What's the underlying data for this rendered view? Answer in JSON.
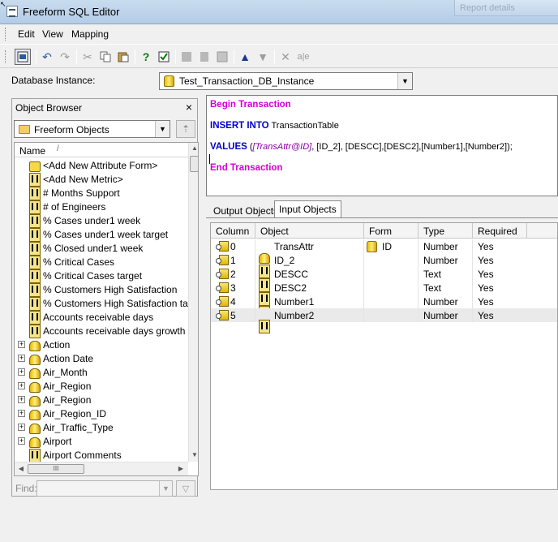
{
  "window": {
    "title": "Freeform SQL Editor",
    "background_window_title": "Report details"
  },
  "menu": {
    "items": [
      "Edit",
      "View",
      "Mapping"
    ]
  },
  "database_instance": {
    "label": "Database Instance:",
    "value": "Test_Transaction_DB_Instance"
  },
  "object_browser": {
    "title": "Object Browser",
    "close": "×",
    "folder": "Freeform Objects",
    "column_header": "Name",
    "sort_indicator": "/",
    "items": [
      {
        "label": "<Add New Attribute Form>",
        "icon": "add-attribute-form-icon",
        "expandable": false
      },
      {
        "label": "<Add New Metric>",
        "icon": "metric-icon",
        "expandable": false
      },
      {
        "label": "# Months Support",
        "icon": "metric-icon",
        "expandable": false
      },
      {
        "label": "# of Engineers",
        "icon": "metric-icon",
        "expandable": false
      },
      {
        "label": "% Cases under1 week",
        "icon": "metric-icon",
        "expandable": false
      },
      {
        "label": "% Cases under1 week target",
        "icon": "metric-icon",
        "expandable": false
      },
      {
        "label": "% Closed under1 week",
        "icon": "metric-icon",
        "expandable": false
      },
      {
        "label": "% Critical Cases",
        "icon": "metric-icon",
        "expandable": false
      },
      {
        "label": "% Critical Cases target",
        "icon": "metric-icon",
        "expandable": false
      },
      {
        "label": "% Customers High Satisfaction",
        "icon": "metric-icon",
        "expandable": false
      },
      {
        "label": "% Customers High Satisfaction ta",
        "icon": "metric-icon",
        "expandable": false
      },
      {
        "label": "Accounts receivable days",
        "icon": "metric-icon",
        "expandable": false
      },
      {
        "label": "Accounts receivable days growth",
        "icon": "metric-icon",
        "expandable": false
      },
      {
        "label": "Action",
        "icon": "attribute-icon",
        "expandable": true
      },
      {
        "label": "Action Date",
        "icon": "attribute-icon",
        "expandable": true
      },
      {
        "label": "Air_Month",
        "icon": "attribute-icon",
        "expandable": true
      },
      {
        "label": "Air_Region",
        "icon": "attribute-icon",
        "expandable": true
      },
      {
        "label": "Air_Region",
        "icon": "attribute-icon",
        "expandable": true
      },
      {
        "label": "Air_Region_ID",
        "icon": "attribute-icon",
        "expandable": true
      },
      {
        "label": "Air_Traffic_Type",
        "icon": "attribute-icon",
        "expandable": true
      },
      {
        "label": "Airport",
        "icon": "attribute-icon",
        "expandable": true
      },
      {
        "label": "Airport Comments",
        "icon": "metric-icon",
        "expandable": false
      }
    ],
    "find_label": "Find:",
    "find_value": "",
    "hscroll_grip": "III"
  },
  "sql": {
    "line1": "Begin Transaction",
    "line2_kw": "INSERT INTO",
    "line2_rest": " TransactionTable",
    "line3_kw": "VALUES",
    "line3_open": " (",
    "line3_italic": "[TransAttr@ID]",
    "line3_rest": ", [ID_2], [DESCC],[DESC2],[Number1],[Number2]);",
    "line4": "End Transaction"
  },
  "tabs": {
    "output": "Output Objects",
    "input": "Input Objects",
    "active": "Input Objects"
  },
  "grid": {
    "headers": [
      "Column",
      "Object",
      "Form",
      "Type",
      "Required"
    ],
    "rows": [
      {
        "column": "0",
        "object": "TransAttr",
        "object_icon": "attribute-icon",
        "form": "ID",
        "type": "Number",
        "required": "Yes"
      },
      {
        "column": "1",
        "object": "ID_2",
        "object_icon": "metric-icon",
        "form": "",
        "type": "Number",
        "required": "Yes"
      },
      {
        "column": "2",
        "object": "DESCC",
        "object_icon": "metric-icon",
        "form": "",
        "type": "Text",
        "required": "Yes"
      },
      {
        "column": "3",
        "object": "DESC2",
        "object_icon": "metric-icon",
        "form": "",
        "type": "Text",
        "required": "Yes"
      },
      {
        "column": "4",
        "object": "Number1",
        "object_icon": "metric-icon",
        "form": "",
        "type": "Number",
        "required": "Yes"
      },
      {
        "column": "5",
        "object": "Number2",
        "object_icon": "metric-icon",
        "form": "",
        "type": "Number",
        "required": "Yes"
      }
    ],
    "selected_row": "5"
  }
}
